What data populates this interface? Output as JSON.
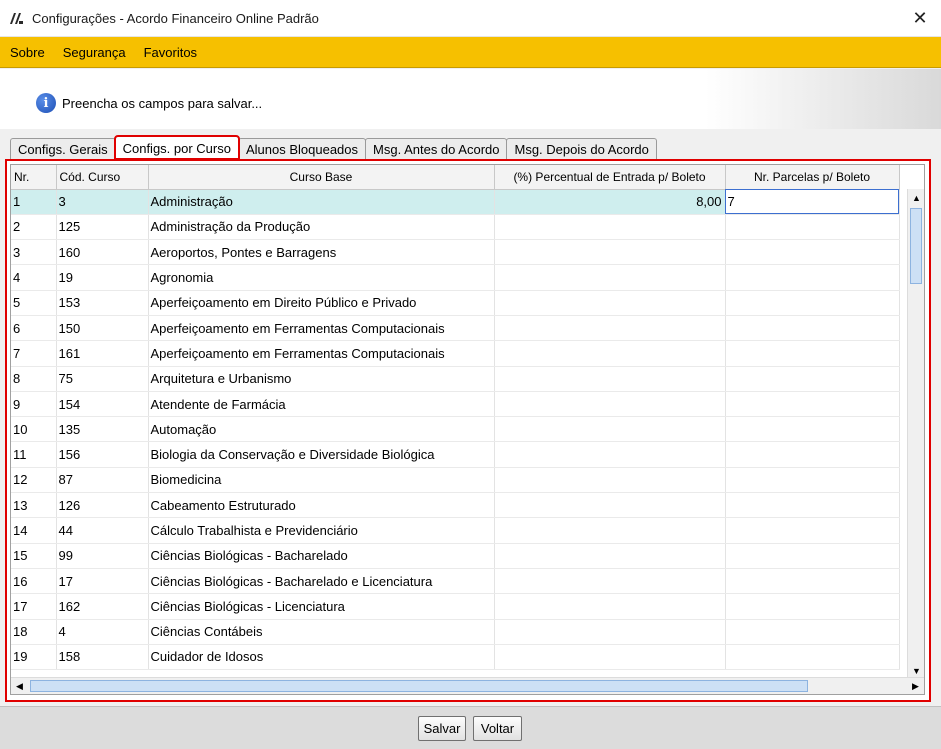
{
  "window": {
    "title": "Configurações - Acordo Financeiro Online Padrão",
    "close_glyph": "✕"
  },
  "menu": [
    "Sobre",
    "Segurança",
    "Favoritos"
  ],
  "info": {
    "text": "Preencha os campos para salvar...",
    "icon_glyph": "i"
  },
  "tabs": [
    "Configs. Gerais",
    "Configs. por Curso",
    "Alunos Bloqueados",
    "Msg. Antes do Acordo",
    "Msg. Depois do Acordo"
  ],
  "active_tab": "Configs. por Curso",
  "grid": {
    "columns": [
      "Nr.",
      "Cód. Curso",
      "Curso Base",
      "(%) Percentual de Entrada p/ Boleto",
      "Nr. Parcelas p/ Boleto"
    ],
    "rows": [
      [
        "1",
        "3",
        "Administração",
        "8,00",
        "7"
      ],
      [
        "2",
        "125",
        "Administração da Produção",
        "",
        ""
      ],
      [
        "3",
        "160",
        "Aeroportos, Pontes e Barragens",
        "",
        ""
      ],
      [
        "4",
        "19",
        "Agronomia",
        "",
        ""
      ],
      [
        "5",
        "153",
        "Aperfeiçoamento em Direito Público e Privado",
        "",
        ""
      ],
      [
        "6",
        "150",
        "Aperfeiçoamento em Ferramentas Computacionais",
        "",
        ""
      ],
      [
        "7",
        "161",
        "Aperfeiçoamento em Ferramentas Computacionais",
        "",
        ""
      ],
      [
        "8",
        "75",
        "Arquitetura e Urbanismo",
        "",
        ""
      ],
      [
        "9",
        "154",
        "Atendente de Farmácia",
        "",
        ""
      ],
      [
        "10",
        "135",
        "Automação",
        "",
        ""
      ],
      [
        "11",
        "156",
        "Biologia da Conservação e Diversidade Biológica",
        "",
        ""
      ],
      [
        "12",
        "87",
        "Biomedicina",
        "",
        ""
      ],
      [
        "13",
        "126",
        "Cabeamento Estruturado",
        "",
        ""
      ],
      [
        "14",
        "44",
        "Cálculo Trabalhista e Previdenciário",
        "",
        ""
      ],
      [
        "15",
        "99",
        "Ciências Biológicas - Bacharelado",
        "",
        ""
      ],
      [
        "16",
        "17",
        "Ciências Biológicas - Bacharelado e Licenciatura",
        "",
        ""
      ],
      [
        "17",
        "162",
        "Ciências Biológicas - Licenciatura",
        "",
        ""
      ],
      [
        "18",
        "4",
        "Ciências Contábeis",
        "",
        ""
      ],
      [
        "19",
        "158",
        "Cuidador de Idosos",
        "",
        ""
      ]
    ],
    "selected_row": 0
  },
  "buttons": {
    "save": "Salvar",
    "back": "Voltar"
  },
  "colors": {
    "menubar": "#f6c000",
    "highlight": "#e00000",
    "selected_row": "#cfeeee"
  }
}
